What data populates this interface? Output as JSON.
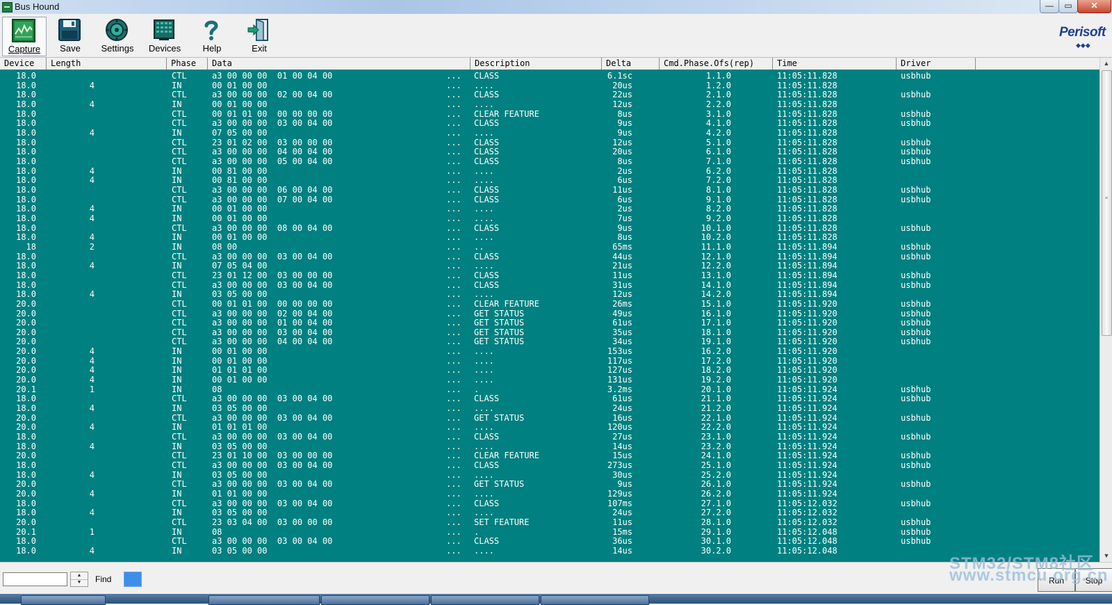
{
  "window": {
    "title": "Bus Hound",
    "minimize": "—",
    "maximize": "▭",
    "close": "✕"
  },
  "toolbar": {
    "capture": "Capture",
    "save": "Save",
    "settings": "Settings",
    "devices": "Devices",
    "help": "Help",
    "exit": "Exit"
  },
  "brand": {
    "name": "Perisoft",
    "dots": "◆◆◆"
  },
  "columns": {
    "device": "Device",
    "length": "Length",
    "phase": "Phase",
    "data": "Data",
    "description": "Description",
    "delta": "Delta",
    "cmd": "Cmd.Phase.Ofs(rep)",
    "time": "Time",
    "driver": "Driver"
  },
  "rows": [
    [
      "18.0",
      "",
      "CTL",
      "a3 00 00 00  01 00 04 00",
      "CLASS",
      "6.1sc",
      "1.1.0",
      "11:05:11.828",
      "usbhub"
    ],
    [
      "18.0",
      "4",
      "IN",
      "00 01 00 00",
      "....",
      "20us",
      "1.2.0",
      "11:05:11.828",
      ""
    ],
    [
      "18.0",
      "",
      "CTL",
      "a3 00 00 00  02 00 04 00",
      "CLASS",
      "22us",
      "2.1.0",
      "11:05:11.828",
      "usbhub"
    ],
    [
      "18.0",
      "4",
      "IN",
      "00 01 00 00",
      "....",
      "12us",
      "2.2.0",
      "11:05:11.828",
      ""
    ],
    [
      "18.0",
      "",
      "CTL",
      "00 01 01 00  00 00 00 00",
      "CLEAR FEATURE",
      "8us",
      "3.1.0",
      "11:05:11.828",
      "usbhub"
    ],
    [
      "18.0",
      "",
      "CTL",
      "a3 00 00 00  03 00 04 00",
      "CLASS",
      "9us",
      "4.1.0",
      "11:05:11.828",
      "usbhub"
    ],
    [
      "18.0",
      "4",
      "IN",
      "07 05 00 00",
      "....",
      "9us",
      "4.2.0",
      "11:05:11.828",
      ""
    ],
    [
      "18.0",
      "",
      "CTL",
      "23 01 02 00  03 00 00 00",
      "CLASS",
      "12us",
      "5.1.0",
      "11:05:11.828",
      "usbhub"
    ],
    [
      "18.0",
      "",
      "CTL",
      "a3 00 00 00  04 00 04 00",
      "CLASS",
      "20us",
      "6.1.0",
      "11:05:11.828",
      "usbhub"
    ],
    [
      "18.0",
      "",
      "CTL",
      "a3 00 00 00  05 00 04 00",
      "CLASS",
      "8us",
      "7.1.0",
      "11:05:11.828",
      "usbhub"
    ],
    [
      "18.0",
      "4",
      "IN",
      "00 81 00 00",
      "....",
      "2us",
      "6.2.0",
      "11:05:11.828",
      ""
    ],
    [
      "18.0",
      "4",
      "IN",
      "00 81 00 00",
      "....",
      "6us",
      "7.2.0",
      "11:05:11.828",
      ""
    ],
    [
      "18.0",
      "",
      "CTL",
      "a3 00 00 00  06 00 04 00",
      "CLASS",
      "11us",
      "8.1.0",
      "11:05:11.828",
      "usbhub"
    ],
    [
      "18.0",
      "",
      "CTL",
      "a3 00 00 00  07 00 04 00",
      "CLASS",
      "6us",
      "9.1.0",
      "11:05:11.828",
      "usbhub"
    ],
    [
      "18.0",
      "4",
      "IN",
      "00 01 00 00",
      "....",
      "2us",
      "8.2.0",
      "11:05:11.828",
      ""
    ],
    [
      "18.0",
      "4",
      "IN",
      "00 01 00 00",
      "....",
      "7us",
      "9.2.0",
      "11:05:11.828",
      ""
    ],
    [
      "18.0",
      "",
      "CTL",
      "a3 00 00 00  08 00 04 00",
      "CLASS",
      "9us",
      "10.1.0",
      "11:05:11.828",
      "usbhub"
    ],
    [
      "18.0",
      "4",
      "IN",
      "00 01 00 00",
      "....",
      "8us",
      "10.2.0",
      "11:05:11.828",
      ""
    ],
    [
      "18",
      "2",
      "IN",
      "08 00",
      "..",
      "65ms",
      "11.1.0",
      "11:05:11.894",
      "usbhub"
    ],
    [
      "18.0",
      "",
      "CTL",
      "a3 00 00 00  03 00 04 00",
      "CLASS",
      "44us",
      "12.1.0",
      "11:05:11.894",
      "usbhub"
    ],
    [
      "18.0",
      "4",
      "IN",
      "07 05 04 00",
      "....",
      "21us",
      "12.2.0",
      "11:05:11.894",
      ""
    ],
    [
      "18.0",
      "",
      "CTL",
      "23 01 12 00  03 00 00 00",
      "CLASS",
      "11us",
      "13.1.0",
      "11:05:11.894",
      "usbhub"
    ],
    [
      "18.0",
      "",
      "CTL",
      "a3 00 00 00  03 00 04 00",
      "CLASS",
      "31us",
      "14.1.0",
      "11:05:11.894",
      "usbhub"
    ],
    [
      "18.0",
      "4",
      "IN",
      "03 05 00 00",
      "....",
      "12us",
      "14.2.0",
      "11:05:11.894",
      ""
    ],
    [
      "20.0",
      "",
      "CTL",
      "00 01 01 00  00 00 00 00",
      "CLEAR FEATURE",
      "26ms",
      "15.1.0",
      "11:05:11.920",
      "usbhub"
    ],
    [
      "20.0",
      "",
      "CTL",
      "a3 00 00 00  02 00 04 00",
      "GET STATUS",
      "49us",
      "16.1.0",
      "11:05:11.920",
      "usbhub"
    ],
    [
      "20.0",
      "",
      "CTL",
      "a3 00 00 00  01 00 04 00",
      "GET STATUS",
      "61us",
      "17.1.0",
      "11:05:11.920",
      "usbhub"
    ],
    [
      "20.0",
      "",
      "CTL",
      "a3 00 00 00  03 00 04 00",
      "GET STATUS",
      "35us",
      "18.1.0",
      "11:05:11.920",
      "usbhub"
    ],
    [
      "20.0",
      "",
      "CTL",
      "a3 00 00 00  04 00 04 00",
      "GET STATUS",
      "34us",
      "19.1.0",
      "11:05:11.920",
      "usbhub"
    ],
    [
      "20.0",
      "4",
      "IN",
      "00 01 00 00",
      "....",
      "153us",
      "16.2.0",
      "11:05:11.920",
      ""
    ],
    [
      "20.0",
      "4",
      "IN",
      "00 01 00 00",
      "....",
      "117us",
      "17.2.0",
      "11:05:11.920",
      ""
    ],
    [
      "20.0",
      "4",
      "IN",
      "01 01 01 00",
      "....",
      "127us",
      "18.2.0",
      "11:05:11.920",
      ""
    ],
    [
      "20.0",
      "4",
      "IN",
      "00 01 00 00",
      "....",
      "131us",
      "19.2.0",
      "11:05:11.920",
      ""
    ],
    [
      "20.1",
      "1",
      "IN",
      "08",
      ".",
      "3.2ms",
      "20.1.0",
      "11:05:11.924",
      "usbhub"
    ],
    [
      "18.0",
      "",
      "CTL",
      "a3 00 00 00  03 00 04 00",
      "CLASS",
      "61us",
      "21.1.0",
      "11:05:11.924",
      "usbhub"
    ],
    [
      "18.0",
      "4",
      "IN",
      "03 05 00 00",
      "....",
      "24us",
      "21.2.0",
      "11:05:11.924",
      ""
    ],
    [
      "20.0",
      "",
      "CTL",
      "a3 00 00 00  03 00 04 00",
      "GET STATUS",
      "16us",
      "22.1.0",
      "11:05:11.924",
      "usbhub"
    ],
    [
      "20.0",
      "4",
      "IN",
      "01 01 01 00",
      "....",
      "120us",
      "22.2.0",
      "11:05:11.924",
      ""
    ],
    [
      "18.0",
      "",
      "CTL",
      "a3 00 00 00  03 00 04 00",
      "CLASS",
      "27us",
      "23.1.0",
      "11:05:11.924",
      "usbhub"
    ],
    [
      "18.0",
      "4",
      "IN",
      "03 05 00 00",
      "....",
      "14us",
      "23.2.0",
      "11:05:11.924",
      ""
    ],
    [
      "20.0",
      "",
      "CTL",
      "23 01 10 00  03 00 00 00",
      "CLEAR FEATURE",
      "15us",
      "24.1.0",
      "11:05:11.924",
      "usbhub"
    ],
    [
      "18.0",
      "",
      "CTL",
      "a3 00 00 00  03 00 04 00",
      "CLASS",
      "273us",
      "25.1.0",
      "11:05:11.924",
      "usbhub"
    ],
    [
      "18.0",
      "4",
      "IN",
      "03 05 00 00",
      "....",
      "30us",
      "25.2.0",
      "11:05:11.924",
      ""
    ],
    [
      "20.0",
      "",
      "CTL",
      "a3 00 00 00  03 00 04 00",
      "GET STATUS",
      "9us",
      "26.1.0",
      "11:05:11.924",
      "usbhub"
    ],
    [
      "20.0",
      "4",
      "IN",
      "01 01 00 00",
      "....",
      "129us",
      "26.2.0",
      "11:05:11.924",
      ""
    ],
    [
      "18.0",
      "",
      "CTL",
      "a3 00 00 00  03 00 04 00",
      "CLASS",
      "107ms",
      "27.1.0",
      "11:05:12.032",
      "usbhub"
    ],
    [
      "18.0",
      "4",
      "IN",
      "03 05 00 00",
      "....",
      "24us",
      "27.2.0",
      "11:05:12.032",
      ""
    ],
    [
      "20.0",
      "",
      "CTL",
      "23 03 04 00  03 00 00 00",
      "SET FEATURE",
      "11us",
      "28.1.0",
      "11:05:12.032",
      "usbhub"
    ],
    [
      "20.1",
      "1",
      "IN",
      "08",
      ".",
      "15ms",
      "29.1.0",
      "11:05:12.048",
      "usbhub"
    ],
    [
      "18.0",
      "",
      "CTL",
      "a3 00 00 00  03 00 04 00",
      "CLASS",
      "36us",
      "30.1.0",
      "11:05:12.048",
      "usbhub"
    ],
    [
      "18.0",
      "4",
      "IN",
      "03 05 00 00",
      "....",
      "14us",
      "30.2.0",
      "11:05:12.048",
      ""
    ]
  ],
  "row_dots": "...",
  "find": {
    "value": "",
    "label": "Find"
  },
  "buttons": {
    "run": "Run",
    "stop": "Stop"
  },
  "watermark": {
    "line1": "STM32/STM8社区",
    "line2": "www.stmcu.org.cn"
  },
  "icons": {
    "capture": "capture-icon",
    "save": "save-icon",
    "settings": "settings-icon",
    "devices": "devices-icon",
    "help": "help-icon",
    "exit": "exit-icon"
  },
  "colors": {
    "grid_background": "#008080",
    "grid_text": "#ffffff",
    "progress": "#3d8fe8"
  }
}
